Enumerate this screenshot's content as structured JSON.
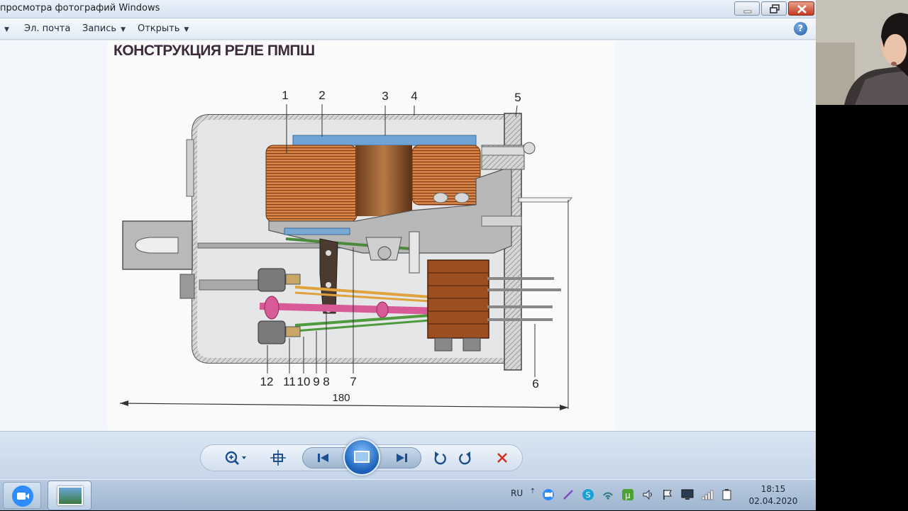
{
  "window": {
    "title": "просмотра фотографий Windows",
    "colors": {
      "titlebar": "#dbe6f1",
      "close": "#c43a1f"
    }
  },
  "menu": {
    "items": [
      {
        "label": "Эл. почта",
        "has_dropdown": false
      },
      {
        "label": "Запись",
        "has_dropdown": true
      },
      {
        "label": "Открыть",
        "has_dropdown": true
      }
    ],
    "help_icon": "help-icon"
  },
  "photo": {
    "title": "КОНСТРУКЦИЯ РЕЛЕ ПМПШ",
    "callouts_top": [
      "1",
      "2",
      "3",
      "4",
      "5"
    ],
    "callouts_bottom": [
      "12",
      "11",
      "10",
      "9",
      "8",
      "7"
    ],
    "callout_side": "6",
    "dimension": "180"
  },
  "controls": {
    "buttons": [
      "zoom-icon",
      "actual-size-icon",
      "previous-icon",
      "slideshow-icon",
      "next-icon",
      "rotate-left-icon",
      "rotate-right-icon",
      "delete-icon"
    ]
  },
  "taskbar": {
    "apps": [
      "zoom-app-icon",
      "photo-viewer-app-icon"
    ],
    "language": "RU",
    "time": "18:15",
    "date": "02.04.2020"
  }
}
